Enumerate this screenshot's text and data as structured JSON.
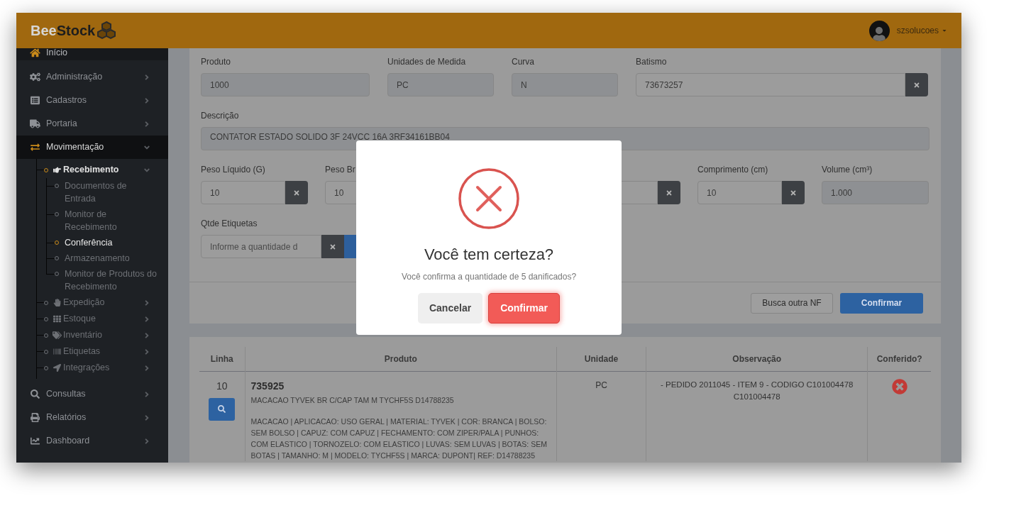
{
  "header": {
    "logo_part_1": "Bee",
    "logo_part_2": "Stock",
    "user": "szsolucoes"
  },
  "sidebar": {
    "items": [
      {
        "label": "Início",
        "selected": false
      },
      {
        "label": "Administração",
        "selected": false,
        "expanded": false
      },
      {
        "label": "Cadastros",
        "selected": false,
        "expanded": false
      },
      {
        "label": "Portaria",
        "selected": false,
        "expanded": false
      },
      {
        "label": "Movimentação",
        "selected": true,
        "expanded": true,
        "children": [
          {
            "label": "Recebimento",
            "selected": true,
            "expanded": true,
            "children": [
              {
                "label": "Documentos de Entrada",
                "selected": false
              },
              {
                "label": "Monitor de Recebimento",
                "selected": false
              },
              {
                "label": "Conferência",
                "selected": true
              },
              {
                "label": "Armazenamento",
                "selected": false
              },
              {
                "label": "Monitor de Produtos do Recebimento",
                "selected": false
              }
            ]
          },
          {
            "label": "Expedição",
            "selected": false,
            "expanded": false
          },
          {
            "label": "Estoque",
            "selected": false,
            "expanded": false
          },
          {
            "label": "Inventário",
            "selected": false,
            "expanded": false
          },
          {
            "label": "Etiquetas",
            "selected": false,
            "expanded": false
          },
          {
            "label": "Integrações",
            "selected": false,
            "expanded": false
          }
        ]
      },
      {
        "label": "Consultas",
        "selected": false,
        "expanded": false
      },
      {
        "label": "Relatórios",
        "selected": false,
        "expanded": false
      },
      {
        "label": "Dashboard",
        "selected": false,
        "expanded": false
      }
    ]
  },
  "form": {
    "row_1": [
      {
        "label": "Produto",
        "value": "1000",
        "kind": "readonly"
      },
      {
        "label": "Unidades de Medida",
        "value": "PC",
        "kind": "readonly"
      },
      {
        "label": "Curva",
        "value": "N",
        "kind": "readonly"
      },
      {
        "label": "Batismo",
        "value": "73673257",
        "kind": "clearable"
      }
    ],
    "description": {
      "label": "Descrição",
      "value": "CONTATOR ESTADO SOLIDO 3F 24VCC 16A 3RF34161BB04"
    },
    "row_3": [
      {
        "label": "Peso Líquido (G)",
        "value": "10",
        "kind": "clearable"
      },
      {
        "label": "Peso Br",
        "value": "10",
        "kind": "plain"
      },
      {
        "kind": "covered"
      },
      {
        "kind": "clearable"
      },
      {
        "label": "Comprimento (cm)",
        "value": "10",
        "kind": "clearable"
      },
      {
        "label": "Volume (cm³)",
        "value": "1.000",
        "kind": "readonly"
      }
    ],
    "labels_qty": {
      "label": "Qtde Etiquetas",
      "placeholder": "Informe a quantidade d"
    },
    "buttons": [
      {
        "label": "Busca outra NF",
        "kind": "secondary"
      },
      {
        "label": "Confirmar",
        "kind": "primary"
      }
    ]
  },
  "table": {
    "columns": [
      "Linha",
      "Produto",
      "Unidade",
      "Observação",
      "Conferido?"
    ],
    "rows": [
      {
        "linha": "10",
        "code": "735925",
        "name": "MACACAO TYVEK BR C/CAP TAM M TYCHF5S D14788235",
        "details": "MACACAO | APLICACAO: USO GERAL | MATERIAL: TYVEK | COR: BRANCA | BOLSO: SEM BOLSO | CAPUZ: COM CAPUZ | FECHAMENTO: COM ZIPER/PALA | PUNHOS: COM ELASTICO | TORNOZELO: COM ELASTICO | LUVAS: SEM LUVAS | BOTAS: SEM BOTAS | TAMANHO: M | MODELO: TYCHF5S | MARCA: DUPONT| REF: D14788235",
        "unidade": "PC",
        "observacao": "- PEDIDO 2011045 - ITEM 9 - CODIGO C101004478 C101004478",
        "conferido": false
      }
    ]
  },
  "modal": {
    "title": "Você tem certeza?",
    "message": "Você confirma a quantidade de 5 danificados?",
    "buttons": [
      {
        "label": "Cancelar",
        "kind": "cancel"
      },
      {
        "label": "Confirmar",
        "kind": "confirm"
      }
    ]
  }
}
